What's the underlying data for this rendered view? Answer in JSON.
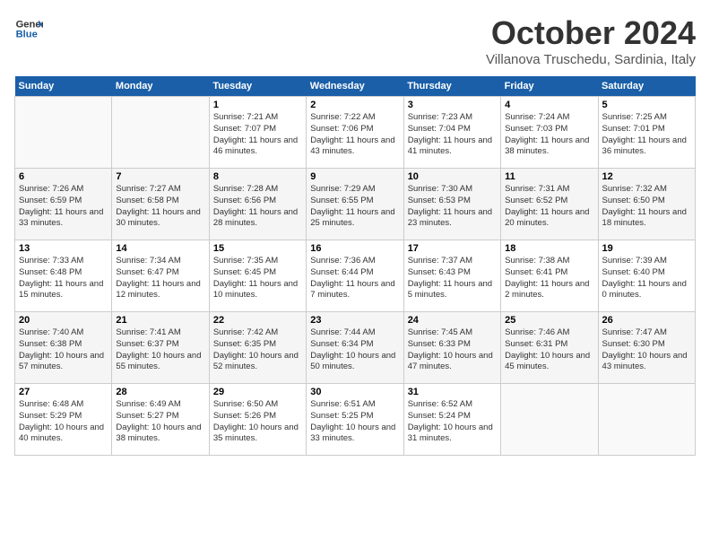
{
  "header": {
    "logo_general": "General",
    "logo_blue": "Blue",
    "month_title": "October 2024",
    "location": "Villanova Truschedu, Sardinia, Italy"
  },
  "weekdays": [
    "Sunday",
    "Monday",
    "Tuesday",
    "Wednesday",
    "Thursday",
    "Friday",
    "Saturday"
  ],
  "weeks": [
    [
      {
        "day": "",
        "info": ""
      },
      {
        "day": "",
        "info": ""
      },
      {
        "day": "1",
        "info": "Sunrise: 7:21 AM\nSunset: 7:07 PM\nDaylight: 11 hours and 46 minutes."
      },
      {
        "day": "2",
        "info": "Sunrise: 7:22 AM\nSunset: 7:06 PM\nDaylight: 11 hours and 43 minutes."
      },
      {
        "day": "3",
        "info": "Sunrise: 7:23 AM\nSunset: 7:04 PM\nDaylight: 11 hours and 41 minutes."
      },
      {
        "day": "4",
        "info": "Sunrise: 7:24 AM\nSunset: 7:03 PM\nDaylight: 11 hours and 38 minutes."
      },
      {
        "day": "5",
        "info": "Sunrise: 7:25 AM\nSunset: 7:01 PM\nDaylight: 11 hours and 36 minutes."
      }
    ],
    [
      {
        "day": "6",
        "info": "Sunrise: 7:26 AM\nSunset: 6:59 PM\nDaylight: 11 hours and 33 minutes."
      },
      {
        "day": "7",
        "info": "Sunrise: 7:27 AM\nSunset: 6:58 PM\nDaylight: 11 hours and 30 minutes."
      },
      {
        "day": "8",
        "info": "Sunrise: 7:28 AM\nSunset: 6:56 PM\nDaylight: 11 hours and 28 minutes."
      },
      {
        "day": "9",
        "info": "Sunrise: 7:29 AM\nSunset: 6:55 PM\nDaylight: 11 hours and 25 minutes."
      },
      {
        "day": "10",
        "info": "Sunrise: 7:30 AM\nSunset: 6:53 PM\nDaylight: 11 hours and 23 minutes."
      },
      {
        "day": "11",
        "info": "Sunrise: 7:31 AM\nSunset: 6:52 PM\nDaylight: 11 hours and 20 minutes."
      },
      {
        "day": "12",
        "info": "Sunrise: 7:32 AM\nSunset: 6:50 PM\nDaylight: 11 hours and 18 minutes."
      }
    ],
    [
      {
        "day": "13",
        "info": "Sunrise: 7:33 AM\nSunset: 6:48 PM\nDaylight: 11 hours and 15 minutes."
      },
      {
        "day": "14",
        "info": "Sunrise: 7:34 AM\nSunset: 6:47 PM\nDaylight: 11 hours and 12 minutes."
      },
      {
        "day": "15",
        "info": "Sunrise: 7:35 AM\nSunset: 6:45 PM\nDaylight: 11 hours and 10 minutes."
      },
      {
        "day": "16",
        "info": "Sunrise: 7:36 AM\nSunset: 6:44 PM\nDaylight: 11 hours and 7 minutes."
      },
      {
        "day": "17",
        "info": "Sunrise: 7:37 AM\nSunset: 6:43 PM\nDaylight: 11 hours and 5 minutes."
      },
      {
        "day": "18",
        "info": "Sunrise: 7:38 AM\nSunset: 6:41 PM\nDaylight: 11 hours and 2 minutes."
      },
      {
        "day": "19",
        "info": "Sunrise: 7:39 AM\nSunset: 6:40 PM\nDaylight: 11 hours and 0 minutes."
      }
    ],
    [
      {
        "day": "20",
        "info": "Sunrise: 7:40 AM\nSunset: 6:38 PM\nDaylight: 10 hours and 57 minutes."
      },
      {
        "day": "21",
        "info": "Sunrise: 7:41 AM\nSunset: 6:37 PM\nDaylight: 10 hours and 55 minutes."
      },
      {
        "day": "22",
        "info": "Sunrise: 7:42 AM\nSunset: 6:35 PM\nDaylight: 10 hours and 52 minutes."
      },
      {
        "day": "23",
        "info": "Sunrise: 7:44 AM\nSunset: 6:34 PM\nDaylight: 10 hours and 50 minutes."
      },
      {
        "day": "24",
        "info": "Sunrise: 7:45 AM\nSunset: 6:33 PM\nDaylight: 10 hours and 47 minutes."
      },
      {
        "day": "25",
        "info": "Sunrise: 7:46 AM\nSunset: 6:31 PM\nDaylight: 10 hours and 45 minutes."
      },
      {
        "day": "26",
        "info": "Sunrise: 7:47 AM\nSunset: 6:30 PM\nDaylight: 10 hours and 43 minutes."
      }
    ],
    [
      {
        "day": "27",
        "info": "Sunrise: 6:48 AM\nSunset: 5:29 PM\nDaylight: 10 hours and 40 minutes."
      },
      {
        "day": "28",
        "info": "Sunrise: 6:49 AM\nSunset: 5:27 PM\nDaylight: 10 hours and 38 minutes."
      },
      {
        "day": "29",
        "info": "Sunrise: 6:50 AM\nSunset: 5:26 PM\nDaylight: 10 hours and 35 minutes."
      },
      {
        "day": "30",
        "info": "Sunrise: 6:51 AM\nSunset: 5:25 PM\nDaylight: 10 hours and 33 minutes."
      },
      {
        "day": "31",
        "info": "Sunrise: 6:52 AM\nSunset: 5:24 PM\nDaylight: 10 hours and 31 minutes."
      },
      {
        "day": "",
        "info": ""
      },
      {
        "day": "",
        "info": ""
      }
    ]
  ]
}
